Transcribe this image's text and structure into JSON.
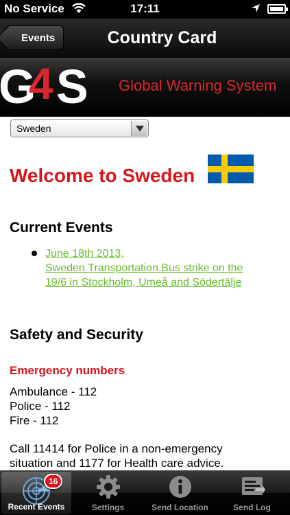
{
  "status_bar": {
    "carrier": "No Service",
    "time": "17:11"
  },
  "nav": {
    "back_label": "Events",
    "title": "Country Card"
  },
  "banner": {
    "system_name": "Global Warning System",
    "logo_text": "G4S"
  },
  "country_select": {
    "selected": "Sweden"
  },
  "content": {
    "welcome": "Welcome to Sweden",
    "current_events_heading": "Current Events",
    "events": [
      {
        "line1": "June 18th 2013,",
        "line2": "Sweden.Transportation.Bus strike on the",
        "line3": "19/6 in Stockholm, Umeå and Södertälje"
      }
    ],
    "safety_heading": "Safety and Security",
    "emergency_heading": "Emergency numbers",
    "emergency_numbers": [
      "Ambulance - 112",
      "Police - 112",
      "Fire - 112"
    ],
    "note_line1": "Call 11414 for Police in a non-emergency",
    "note_line2": "situation and 1177 for Health care advice."
  },
  "tabs": [
    {
      "label": "Recent Events",
      "icon": "radar-icon",
      "badge": "16",
      "active": true
    },
    {
      "label": "Settings",
      "icon": "gear-icon",
      "active": false
    },
    {
      "label": "Send Location",
      "icon": "info-icon",
      "active": false
    },
    {
      "label": "Send Log",
      "icon": "send-log-icon",
      "active": false
    }
  ],
  "colors": {
    "accent_red": "#d9141b",
    "link_green": "#6abd2a",
    "flag_blue": "#005bab",
    "flag_yellow": "#fecb00"
  }
}
